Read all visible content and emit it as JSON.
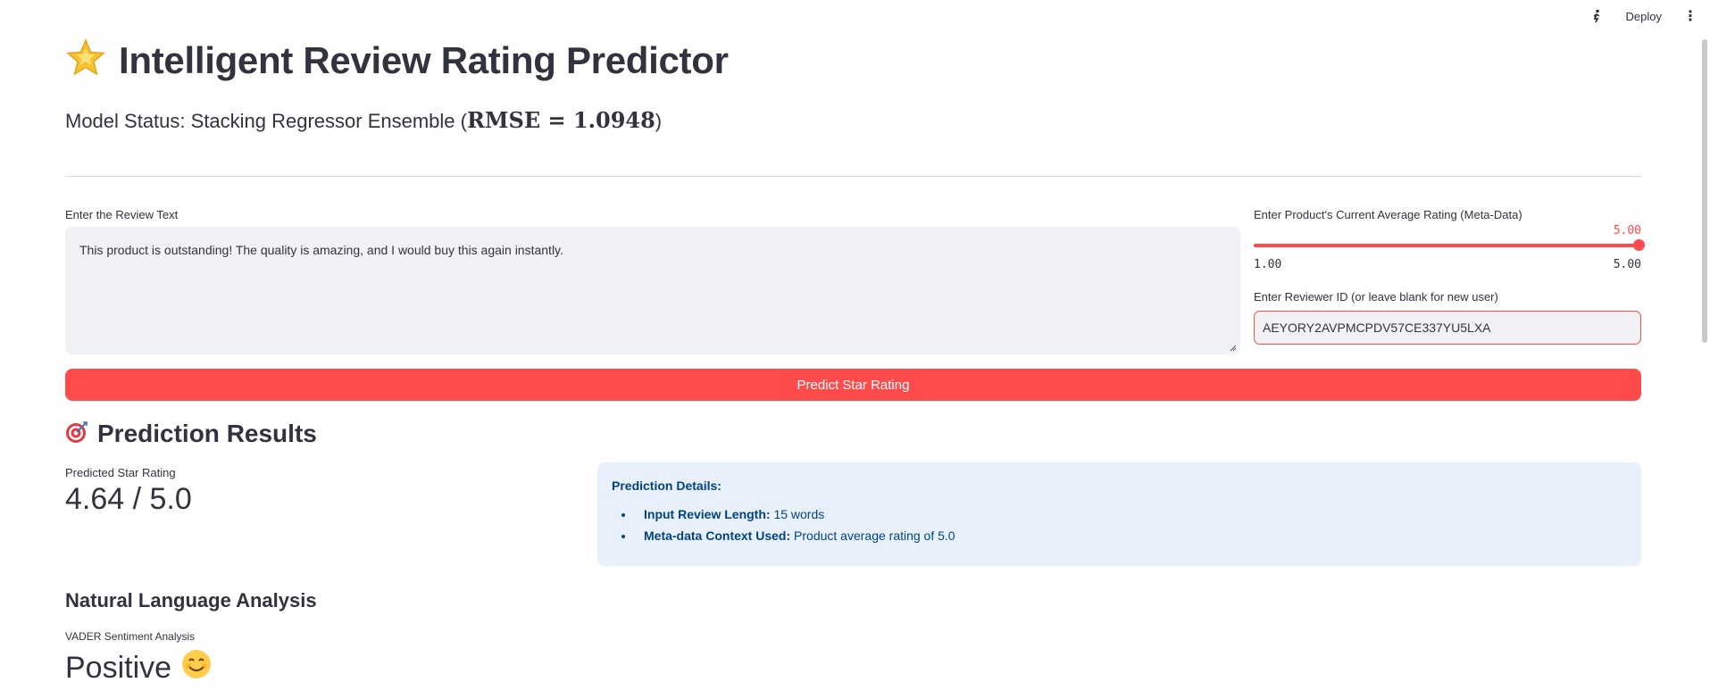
{
  "topbar": {
    "deploy_label": "Deploy",
    "running_icon": "running-man-icon",
    "menu_icon": "kebab-menu-icon"
  },
  "header": {
    "title_icon": "star-icon",
    "title": "Intelligent Review Rating Predictor",
    "status_prefix": "Model Status: Stacking Regressor Ensemble (",
    "status_math": "RMSE = 1.0948",
    "status_suffix": ")"
  },
  "review": {
    "label": "Enter the Review Text",
    "value": "This product is outstanding! The quality is amazing, and I would buy this again instantly."
  },
  "slider": {
    "label": "Enter Product's Current Average Rating (Meta-Data)",
    "value": "5.00",
    "min": "1.00",
    "max": "5.00",
    "level": 1.0,
    "color": "#ff4b4b"
  },
  "reviewer": {
    "label": "Enter Reviewer ID (or leave blank for new user)",
    "value": "AEYORY2AVPMCPDV57CE337YU5LXA"
  },
  "predict_button": {
    "label": "Predict Star Rating",
    "color": "#ff4b4b"
  },
  "results": {
    "icon": "target-icon",
    "heading": "Prediction Results",
    "metric_label": "Predicted Star Rating",
    "metric_value": "4.64 / 5.0",
    "details": {
      "title": "Prediction Details:",
      "items": [
        {
          "key": "Input Review Length:",
          "value": "15 words"
        },
        {
          "key": "Meta-data Context Used:",
          "value": "Product average rating of 5.0"
        }
      ]
    }
  },
  "nla": {
    "heading": "Natural Language Analysis",
    "vader_label": "VADER Sentiment Analysis",
    "vader_value": "Positive",
    "vader_icon": "smiling-face-icon"
  }
}
